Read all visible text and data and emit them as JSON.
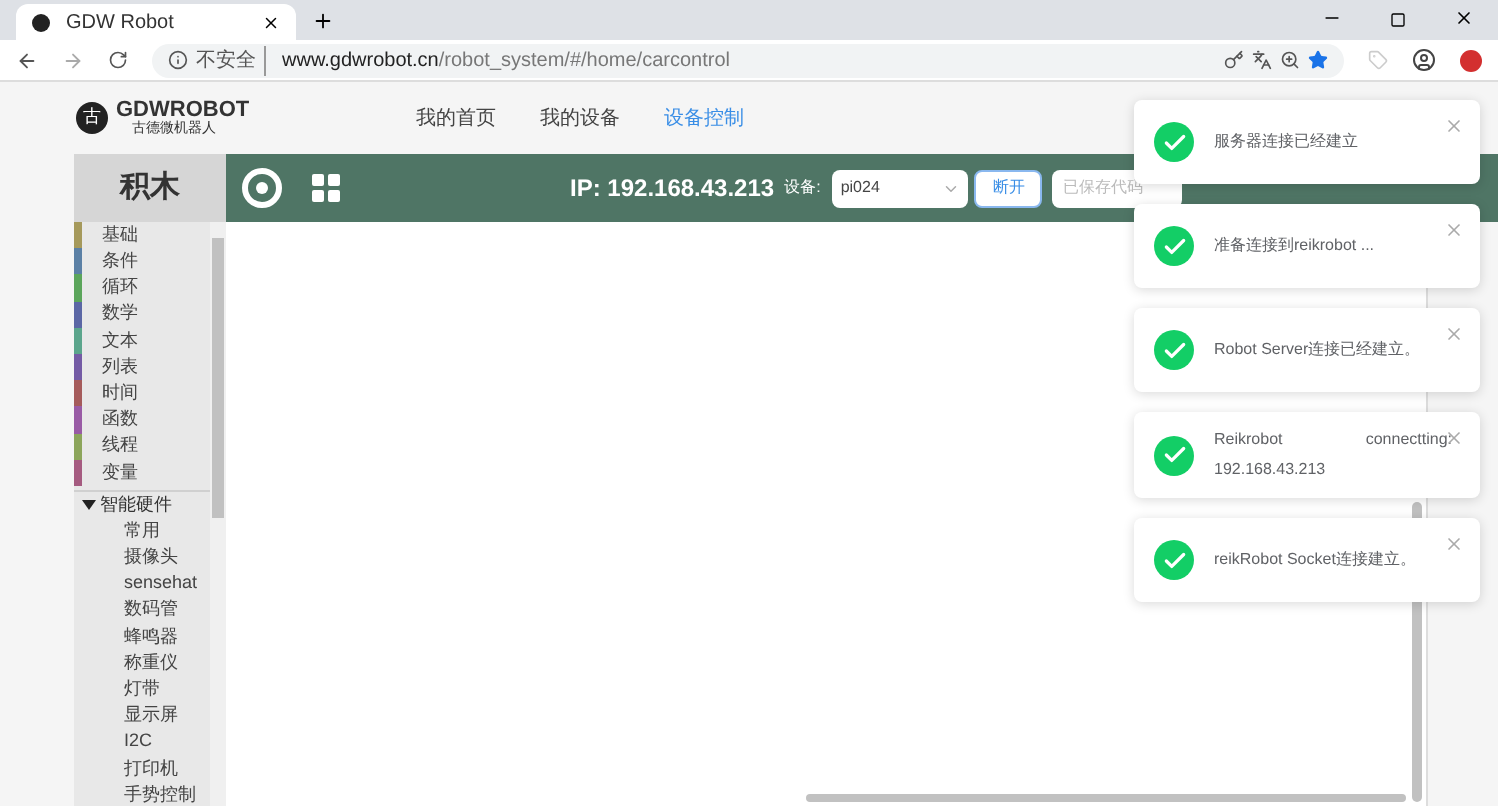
{
  "browser": {
    "tab_title": "GDW Robot",
    "security": "不安全",
    "url_domain": "www.gdwrobot.cn",
    "url_path": "/robot_system/#/home/carcontrol"
  },
  "site": {
    "logo_text": "GDWROBOT",
    "logo_sub": "古德微机器人",
    "logo_mark": "古",
    "nav": [
      {
        "label": "我的首页",
        "selected": false
      },
      {
        "label": "我的设备",
        "selected": false
      },
      {
        "label": "设备控制",
        "selected": true
      }
    ]
  },
  "toolbar": {
    "ip": "IP: 192.168.43.213",
    "device_label": "设备:",
    "device_value": "pi024",
    "disconnect": "断开",
    "saved_code_placeholder": "已保存代码"
  },
  "blocks": {
    "title": "积木",
    "categories": [
      {
        "label": "基础",
        "color": "#a5995b"
      },
      {
        "label": "条件",
        "color": "#5b80a5"
      },
      {
        "label": "循环",
        "color": "#5ba55b"
      },
      {
        "label": "数学",
        "color": "#5b67a5"
      },
      {
        "label": "文本",
        "color": "#5ba58c"
      },
      {
        "label": "列表",
        "color": "#745ba5"
      },
      {
        "label": "时间",
        "color": "#a55b5b"
      },
      {
        "label": "函数",
        "color": "#995ba5"
      },
      {
        "label": "线程",
        "color": "#8ca55b"
      },
      {
        "label": "变量",
        "color": "#a55b80"
      }
    ],
    "tree": {
      "label": "智能硬件",
      "expanded": true,
      "children": [
        "常用",
        "摄像头",
        "sensehat",
        "数码管",
        "蜂鸣器",
        "称重仪",
        "灯带",
        "显示屏",
        "I2C",
        "打印机",
        "手势控制"
      ]
    }
  },
  "notifications": [
    {
      "text": "服务器连接已经建立"
    },
    {
      "text": "准备连接到reikrobot ..."
    },
    {
      "text": "Robot Server连接已经建立。"
    },
    {
      "text": "Reikrobot",
      "detail": "192.168.43.213",
      "status": "connectting:"
    },
    {
      "text": "reikRobot Socket连接建立。"
    }
  ]
}
